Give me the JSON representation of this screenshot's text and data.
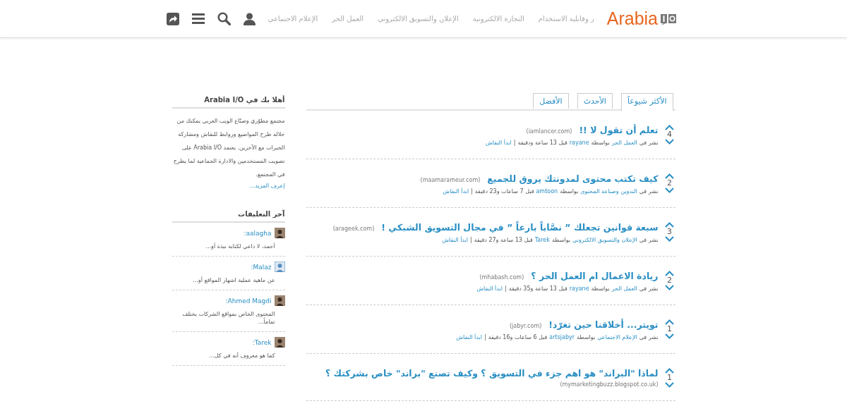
{
  "header": {
    "logo": "Arabia",
    "nav": [
      "ر وقابلية الاستخدام",
      "التجارة الالكترونية",
      "الإعلان والتسويق الالكتروني",
      "العمل الحر",
      "الإعلام الاجتماعي"
    ]
  },
  "tabs": [
    {
      "label": "الأكثر شيوعاً",
      "selected": true
    },
    {
      "label": "الأحدث",
      "selected": false
    },
    {
      "label": "الأفضل",
      "selected": false
    }
  ],
  "posts": [
    {
      "title": "تعلم أن تقول لا !!",
      "domain": "(iamlancer.com)",
      "votes": "4",
      "posted_in": "نشر في",
      "category": "العمل الحر",
      "by": "بواسطة",
      "author": "rayane",
      "time": "قبل 13 ساعة ودقيقة",
      "separator": "|",
      "discuss": "ابدأ النقاش"
    },
    {
      "title": "كيف تكتب محتوى لمدونتك يروق للجميع",
      "domain": "(maamarameur.com)",
      "votes": "2",
      "posted_in": "نشر في",
      "category": "التدوين وصناعة المحتوى",
      "by": "بواسطة",
      "author": "amtoon",
      "time": "قبل 7 ساعات و23 دقيقة",
      "separator": "|",
      "discuss": "ابدأ النقاش"
    },
    {
      "title": "سبعة قوانين تجعلك ” نصَّاباً بارعاً ” في مجال التسويق الشبكي !",
      "domain": "(arageek.com)",
      "votes": "3",
      "posted_in": "نشر في",
      "category": "الإعلان والتسويق الالكتروني",
      "by": "بواسطة",
      "author": "Tarek",
      "time": "قبل 13 ساعة و27 دقيقة",
      "separator": "|",
      "discuss": "ابدأ النقاش"
    },
    {
      "title": "ريادة الاعمال ام العمل الحر ؟",
      "domain": "(mhabash.com)",
      "votes": "2",
      "posted_in": "نشر في",
      "category": "العمل الحر",
      "by": "بواسطة",
      "author": "rayane",
      "time": "قبل 13 ساعة و35 دقيقة",
      "separator": "|",
      "discuss": "ابدأ النقاش"
    },
    {
      "title": "تويتر... أخلاقنا حين تغرّد!",
      "domain": "(jabyr.com)",
      "votes": "1",
      "posted_in": "نشر في",
      "category": "الإعلام الاجتماعي",
      "by": "بواسطة",
      "author": "artsjabyr",
      "time": "قبل 6 ساعات و16 دقيقة",
      "separator": "|",
      "discuss": "ابدأ النقاش"
    },
    {
      "title": "لماذا \"البراند\" هو اهم جزء في التسويق ؟ وكيف تصنع \"براند\" خاص بشركتك ؟",
      "domain": "(mymarketingbuzz.blogspot.co.uk)",
      "votes": "1"
    }
  ],
  "sidebar": {
    "welcome_title": "أهلا بك في Arabia I/O",
    "welcome_text": "مجتمع مطوّري وصنّاع الويب العربي يمكنك من خلاله طرح المواضيع وروابط للنقاش ومشاركة الخبرات مع الآخرين. يعتمد Arabia I/O على تصويت المستخدمين والادارة الجماعية لما يطرح في المجتمع.",
    "learn_more": "إعرف المزيد...",
    "comments_title": "آخر التعليقات",
    "comments": [
      {
        "author": "aalagha:",
        "text": "أحمد، لا داعي لكتابة نبذة أو..."
      },
      {
        "author": "Malaz:",
        "text": "عن ماهية عملية اشهار المواقع أو..."
      },
      {
        "author": "Ahmed Magdi:",
        "text": "المحتوى الخاص بمواقع الشركات يختلف تماماً..."
      },
      {
        "author": "Tarek:",
        "text": "كما هو معروف أنه في كل..."
      }
    ]
  }
}
